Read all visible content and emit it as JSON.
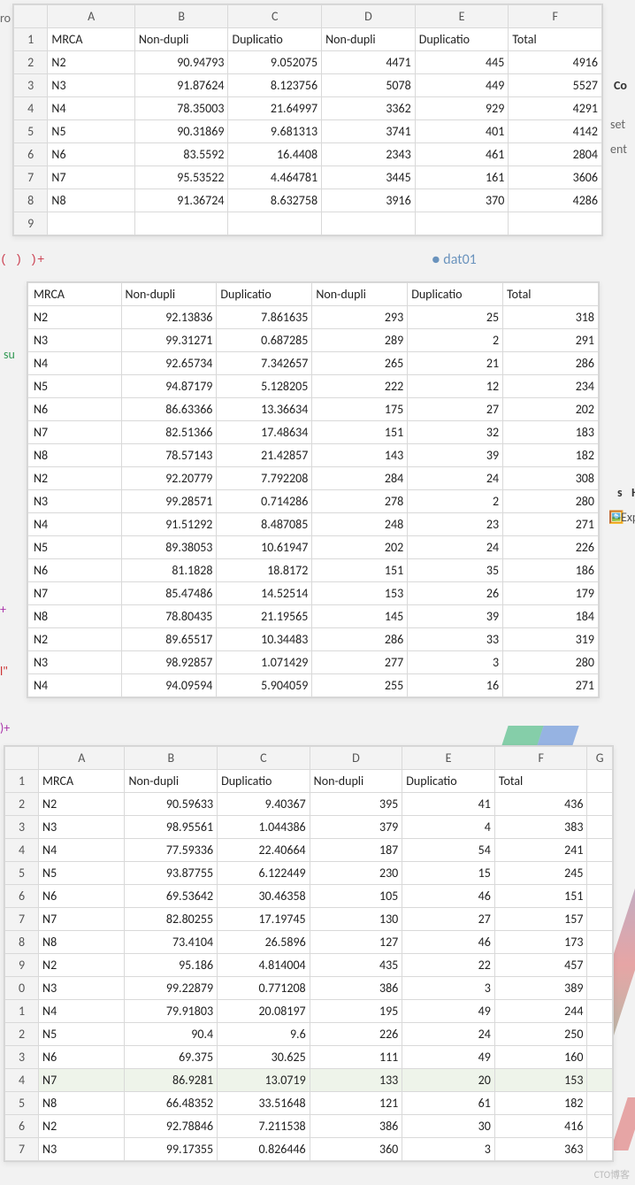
{
  "sheet1": {
    "columns": [
      "A",
      "B",
      "C",
      "D",
      "E",
      "F"
    ],
    "headers": [
      "MRCA",
      "Non-dupli",
      "Duplicatio",
      "Non-dupli",
      "Duplicatio",
      "Total"
    ],
    "row_numbers": [
      "1",
      "2",
      "3",
      "4",
      "5",
      "6",
      "7",
      "8",
      "9"
    ],
    "rows": [
      {
        "a": "N2",
        "b": "90.94793",
        "c": "9.052075",
        "d": "4471",
        "e": "445",
        "f": "4916"
      },
      {
        "a": "N3",
        "b": "91.87624",
        "c": "8.123756",
        "d": "5078",
        "e": "449",
        "f": "5527"
      },
      {
        "a": "N4",
        "b": "78.35003",
        "c": "21.64997",
        "d": "3362",
        "e": "929",
        "f": "4291"
      },
      {
        "a": "N5",
        "b": "90.31869",
        "c": "9.681313",
        "d": "3741",
        "e": "401",
        "f": "4142"
      },
      {
        "a": "N6",
        "b": "83.5592",
        "c": "16.4408",
        "d": "2343",
        "e": "461",
        "f": "2804"
      },
      {
        "a": "N7",
        "b": "95.53522",
        "c": "4.464781",
        "d": "3445",
        "e": "161",
        "f": "3606"
      },
      {
        "a": "N8",
        "b": "91.36724",
        "c": "8.632758",
        "d": "3916",
        "e": "370",
        "f": "4286"
      }
    ]
  },
  "sheet2": {
    "headers": [
      "MRCA",
      "Non-dupli",
      "Duplicatio",
      "Non-dupli",
      "Duplicatio",
      "Total"
    ],
    "rows": [
      {
        "a": "N2",
        "b": "92.13836",
        "c": "7.861635",
        "d": "293",
        "e": "25",
        "f": "318"
      },
      {
        "a": "N3",
        "b": "99.31271",
        "c": "0.687285",
        "d": "289",
        "e": "2",
        "f": "291"
      },
      {
        "a": "N4",
        "b": "92.65734",
        "c": "7.342657",
        "d": "265",
        "e": "21",
        "f": "286"
      },
      {
        "a": "N5",
        "b": "94.87179",
        "c": "5.128205",
        "d": "222",
        "e": "12",
        "f": "234"
      },
      {
        "a": "N6",
        "b": "86.63366",
        "c": "13.36634",
        "d": "175",
        "e": "27",
        "f": "202"
      },
      {
        "a": "N7",
        "b": "82.51366",
        "c": "17.48634",
        "d": "151",
        "e": "32",
        "f": "183"
      },
      {
        "a": "N8",
        "b": "78.57143",
        "c": "21.42857",
        "d": "143",
        "e": "39",
        "f": "182"
      },
      {
        "a": "N2",
        "b": "92.20779",
        "c": "7.792208",
        "d": "284",
        "e": "24",
        "f": "308"
      },
      {
        "a": "N3",
        "b": "99.28571",
        "c": "0.714286",
        "d": "278",
        "e": "2",
        "f": "280"
      },
      {
        "a": "N4",
        "b": "91.51292",
        "c": "8.487085",
        "d": "248",
        "e": "23",
        "f": "271"
      },
      {
        "a": "N5",
        "b": "89.38053",
        "c": "10.61947",
        "d": "202",
        "e": "24",
        "f": "226"
      },
      {
        "a": "N6",
        "b": "81.1828",
        "c": "18.8172",
        "d": "151",
        "e": "35",
        "f": "186"
      },
      {
        "a": "N7",
        "b": "85.47486",
        "c": "14.52514",
        "d": "153",
        "e": "26",
        "f": "179"
      },
      {
        "a": "N8",
        "b": "78.80435",
        "c": "21.19565",
        "d": "145",
        "e": "39",
        "f": "184"
      },
      {
        "a": "N2",
        "b": "89.65517",
        "c": "10.34483",
        "d": "286",
        "e": "33",
        "f": "319"
      },
      {
        "a": "N3",
        "b": "98.92857",
        "c": "1.071429",
        "d": "277",
        "e": "3",
        "f": "280"
      },
      {
        "a": "N4",
        "b": "94.09594",
        "c": "5.904059",
        "d": "255",
        "e": "16",
        "f": "271"
      }
    ]
  },
  "sheet3": {
    "columns": [
      "A",
      "B",
      "C",
      "D",
      "E",
      "F",
      "G"
    ],
    "headers": [
      "MRCA",
      "Non-dupli",
      "Duplicatio",
      "Non-dupli",
      "Duplicatio",
      "Total",
      ""
    ],
    "row_numbers": [
      "1",
      "2",
      "3",
      "4",
      "5",
      "6",
      "7",
      "8",
      "9",
      "0",
      "1",
      "2",
      "3",
      "4",
      "5",
      "6",
      "7"
    ],
    "rows": [
      {
        "a": "N2",
        "b": "90.59633",
        "c": "9.40367",
        "d": "395",
        "e": "41",
        "f": "436"
      },
      {
        "a": "N3",
        "b": "98.95561",
        "c": "1.044386",
        "d": "379",
        "e": "4",
        "f": "383"
      },
      {
        "a": "N4",
        "b": "77.59336",
        "c": "22.40664",
        "d": "187",
        "e": "54",
        "f": "241"
      },
      {
        "a": "N5",
        "b": "93.87755",
        "c": "6.122449",
        "d": "230",
        "e": "15",
        "f": "245"
      },
      {
        "a": "N6",
        "b": "69.53642",
        "c": "30.46358",
        "d": "105",
        "e": "46",
        "f": "151"
      },
      {
        "a": "N7",
        "b": "82.80255",
        "c": "17.19745",
        "d": "130",
        "e": "27",
        "f": "157"
      },
      {
        "a": "N8",
        "b": "73.4104",
        "c": "26.5896",
        "d": "127",
        "e": "46",
        "f": "173"
      },
      {
        "a": "N2",
        "b": "95.186",
        "c": "4.814004",
        "d": "435",
        "e": "22",
        "f": "457"
      },
      {
        "a": "N3",
        "b": "99.22879",
        "c": "0.771208",
        "d": "386",
        "e": "3",
        "f": "389"
      },
      {
        "a": "N4",
        "b": "79.91803",
        "c": "20.08197",
        "d": "195",
        "e": "49",
        "f": "244"
      },
      {
        "a": "N5",
        "b": "90.4",
        "c": "9.6",
        "d": "226",
        "e": "24",
        "f": "250"
      },
      {
        "a": "N6",
        "b": "69.375",
        "c": "30.625",
        "d": "111",
        "e": "49",
        "f": "160"
      },
      {
        "a": "N7",
        "b": "86.9281",
        "c": "13.0719",
        "d": "133",
        "e": "20",
        "f": "153"
      },
      {
        "a": "N8",
        "b": "66.48352",
        "c": "33.51648",
        "d": "121",
        "e": "61",
        "f": "182"
      },
      {
        "a": "N2",
        "b": "92.78846",
        "c": "7.211538",
        "d": "386",
        "e": "30",
        "f": "416"
      },
      {
        "a": "N3",
        "b": "99.17355",
        "c": "0.826446",
        "d": "360",
        "e": "3",
        "f": "363"
      }
    ]
  },
  "fragments": {
    "ro": "ro",
    "paren": "( ) )+",
    "dat": "dat01",
    "su": "su",
    "plus": "+",
    "quote": "l\"",
    "plus2": ")+",
    "co": "Co",
    "set": "set",
    "ent": "ent",
    "s": "s",
    "h": "H",
    "exp": "Exp"
  },
  "watermark": "CTO博客"
}
